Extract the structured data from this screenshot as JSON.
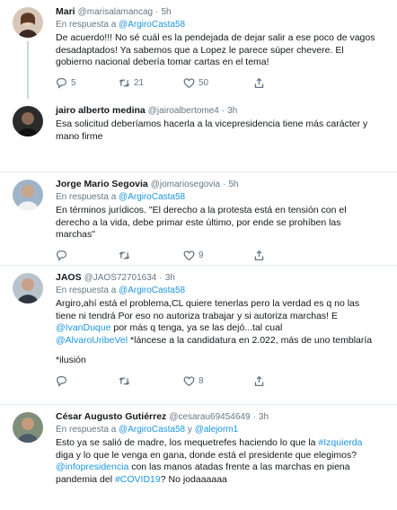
{
  "tweets": [
    {
      "name": "Mari",
      "handle": "@marisalamancag",
      "time": "5h",
      "reply_prefix": "En respuesta a",
      "reply_to": "@ArgiroCasta58",
      "lines": [
        "De acuerdo!!! No sé cuál es la pendejada de dejar salir a ese poco de vagos",
        "desadaptados!   Ya sabemos que a Lopez  le parece súper chevere.  El",
        "gobierno nacional debería tomar cartas en el tema!"
      ],
      "replies": "5",
      "retweets": "21",
      "likes": "50"
    },
    {
      "name": "jairo alberto medina",
      "handle": "@jairoalbertome4",
      "time": "3h",
      "lines": [
        "Esa solicitud deberíamos hacerla  a la vicepresidencia tiene más carácter y",
        "mano firme"
      ]
    },
    {
      "name": "Jorge Mario Segovia",
      "handle": "@jomariosegovia",
      "time": "5h",
      "reply_prefix": "En respuesta a",
      "reply_to": "@ArgiroCasta58",
      "lines": [
        "En términos jurídicos. \"El derecho a la protesta está en tensión con el",
        "derecho a la vida, debe primar este último, por ende se prohíben las",
        "marchas\""
      ],
      "replies": "",
      "retweets": "",
      "likes": "9"
    },
    {
      "name": "JAOS",
      "handle": "@JAOS72701634",
      "time": "3h",
      "reply_prefix": "En respuesta a",
      "reply_to": "@ArgiroCasta58",
      "line1": "Argiro,ahí está el problema,CL quiere tenerlas pero la verdad es q no las",
      "line2": "tiene ni tendrá Por eso no autoriza trabajar y si autoriza marchas! E",
      "mention1": "@IvanDuque",
      "line3_rest": " por más q tenga, ya se las dejó...tal cual",
      "mention2": "@AlvaroUribeVel",
      "line4_rest": " *láncese a la candidatura en 2.022, más de uno temblaría",
      "line5": "*ilusión",
      "replies": "",
      "retweets": "",
      "likes": "8"
    },
    {
      "name": "César Augusto Gutiérrez",
      "handle": "@cesarau69454649",
      "time": "3h",
      "reply_prefix": "En respuesta a",
      "reply_to": "@ArgiroCasta58",
      "reply_and": "y",
      "reply_to2": "@alejorm1",
      "l1a": "Esto ya se salió de madre, los mequetrefes haciendo lo que la ",
      "l1tag": "#Izquierda",
      "l2": "diga y lo que le venga en gana, donde está el presidente que elegimos?",
      "l3mention": "@infopresidencia",
      "l3rest": " con las manos atadas frente a las marchas en piena",
      "l4a": "pandemia del ",
      "l4tag": "#COVID19",
      "l4rest": "? No jodaaaaaa"
    }
  ]
}
